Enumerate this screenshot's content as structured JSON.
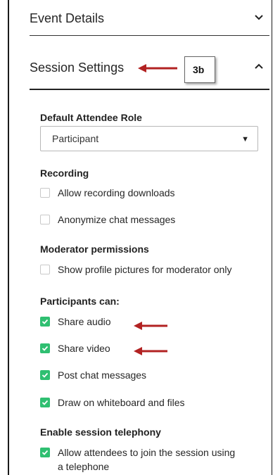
{
  "sections": {
    "event_details": {
      "title": "Event Details",
      "chevron": "chevron-down-icon"
    },
    "session_settings": {
      "title": "Session Settings",
      "chevron": "chevron-up-icon"
    }
  },
  "callout": {
    "label": "3b",
    "arrow_color": "#b22222"
  },
  "default_role": {
    "heading": "Default Attendee Role",
    "selected": "Participant"
  },
  "recording": {
    "heading": "Recording",
    "options": [
      {
        "label": "Allow recording downloads",
        "checked": false
      },
      {
        "label": "Anonymize chat messages",
        "checked": false
      }
    ]
  },
  "moderator": {
    "heading": "Moderator permissions",
    "options": [
      {
        "label": "Show profile pictures for moderator only",
        "checked": false
      }
    ]
  },
  "participants": {
    "heading": "Participants can:",
    "options": [
      {
        "label": "Share audio",
        "checked": true
      },
      {
        "label": "Share video",
        "checked": true
      },
      {
        "label": "Post chat messages",
        "checked": true
      },
      {
        "label": "Draw on whiteboard and files",
        "checked": true
      }
    ]
  },
  "telephony": {
    "heading": "Enable session telephony",
    "option_line1": "Allow attendees to join the session using",
    "option_line2": "a telephone",
    "checked": true
  },
  "colors": {
    "check_green": "#2fbf71",
    "arrow_red": "#b22222"
  }
}
